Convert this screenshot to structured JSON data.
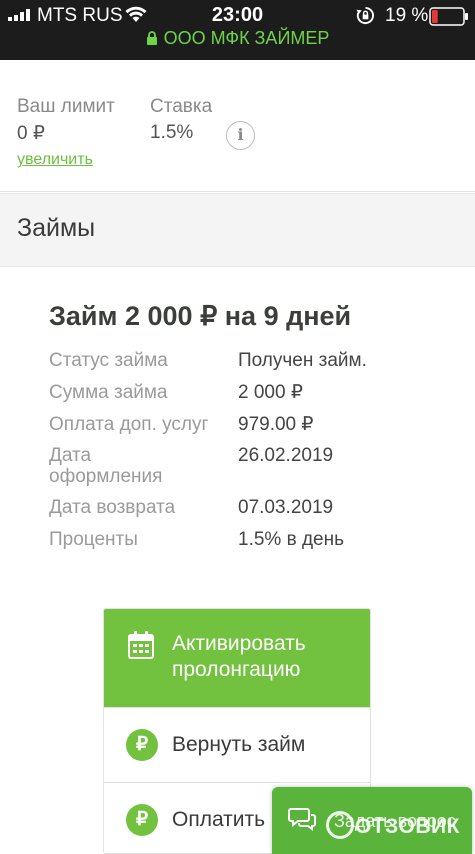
{
  "status_bar": {
    "carrier": "MTS RUS",
    "time": "23:00",
    "battery_percent": "19 %",
    "battery_level": 0.19,
    "site_label": "ООО МФК ЗАЙМЕР"
  },
  "limit": {
    "limit_label": "Ваш лимит",
    "limit_value": "0 ₽",
    "increase_link": "увеличить",
    "rate_label": "Ставка",
    "rate_value": "1.5%",
    "info_glyph": "i"
  },
  "loans": {
    "header": "Займы"
  },
  "loan": {
    "title": "Займ 2 000 ₽ на 9 дней",
    "details": [
      {
        "label": "Статус займа",
        "value": "Получен займ."
      },
      {
        "label": "Сумма займа",
        "value": "2 000 ₽"
      },
      {
        "label": "Оплата доп. услуг",
        "value": "979.00 ₽"
      },
      {
        "label": "Дата\nоформления",
        "value": "26.02.2019"
      },
      {
        "label": "Дата возврата",
        "value": "07.03.2019"
      },
      {
        "label": "Проценты",
        "value": "1.5% в день"
      }
    ]
  },
  "actions": {
    "prolong": "Активировать\nпролонгацию",
    "return": "Вернуть займ",
    "pay": "Оплатить",
    "rub_glyph": "₽"
  },
  "chat": {
    "label": "Задать вопрос"
  },
  "watermark": {
    "text": "ОТЗОВИК"
  },
  "colors": {
    "accent_green": "#72c23f",
    "secure_green": "#6fd34a",
    "battery_low": "#e53935"
  }
}
